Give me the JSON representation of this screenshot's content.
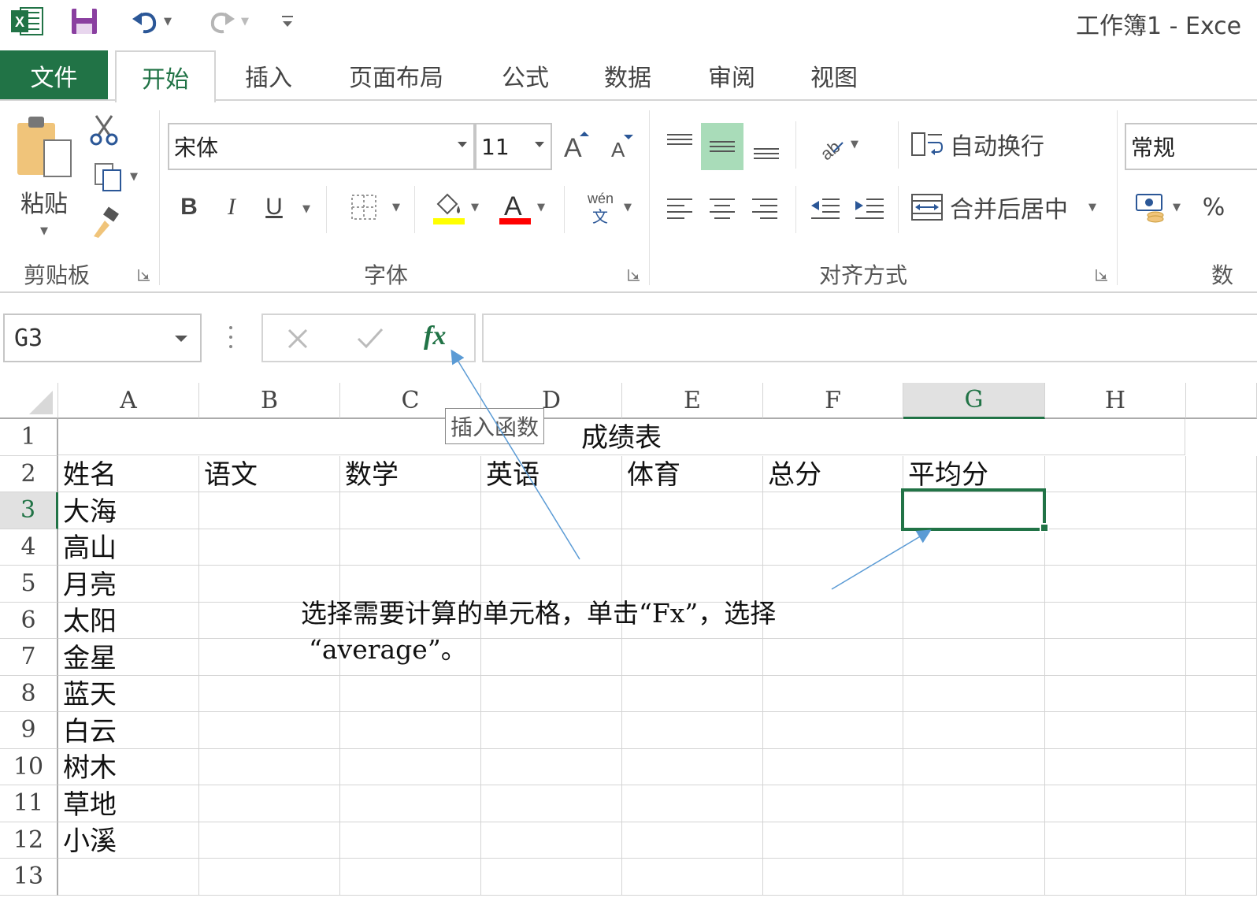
{
  "window": {
    "title": "工作簿1 - Exce"
  },
  "tabs": [
    "文件",
    "开始",
    "插入",
    "页面布局",
    "公式",
    "数据",
    "审阅",
    "视图"
  ],
  "ribbon": {
    "clipboard": {
      "paste_label": "粘贴",
      "group_label": "剪贴板"
    },
    "font": {
      "font_name": "宋体",
      "font_size": "11",
      "group_label": "字体",
      "bold": "B",
      "italic": "I",
      "underline": "U",
      "font_color_letter": "A",
      "highlight_color": "#ffff00",
      "font_color": "#ff0000"
    },
    "alignment": {
      "wrap_text": "自动换行",
      "merge_center": "合并后居中",
      "group_label": "对齐方式"
    },
    "number": {
      "format": "常规",
      "percent": "%",
      "group_label": "数"
    }
  },
  "formula_bar": {
    "name_box": "G3",
    "fx_label": "fx",
    "value": ""
  },
  "sheet": {
    "columns": [
      "A",
      "B",
      "C",
      "D",
      "E",
      "F",
      "G",
      "H"
    ],
    "selected_column": "G",
    "rows": [
      "1",
      "2",
      "3",
      "4",
      "5",
      "6",
      "7",
      "8",
      "9",
      "10",
      "11",
      "12",
      "13"
    ],
    "selected_row": "3",
    "title": "成绩表",
    "headers": [
      "姓名",
      "语文",
      "数学",
      "英语",
      "体育",
      "总分",
      "平均分"
    ],
    "names": [
      "大海",
      "高山",
      "月亮",
      "太阳",
      "金星",
      "蓝天",
      "白云",
      "树木",
      "草地",
      "小溪"
    ]
  },
  "tooltip": "插入函数",
  "annotation": {
    "line1": "选择需要计算的单元格，单击“Fx”，选择",
    "line2": "“average”。"
  },
  "colors": {
    "accent": "#217346",
    "arrow": "#5b9bd5"
  }
}
